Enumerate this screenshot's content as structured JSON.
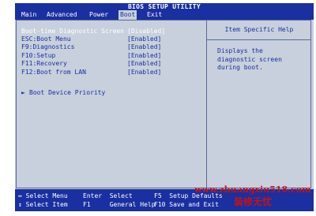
{
  "window": {
    "title": "BIOS SETUP UTILITY"
  },
  "menubar": {
    "items": [
      "Main",
      "Advanced",
      "Power",
      "Boot",
      "Exit"
    ],
    "active": "Boot"
  },
  "settings": [
    {
      "label": "Boot-time Diagnostic Screen",
      "value": "[Disabled]",
      "selected": true
    },
    {
      "label": "ESC:Boot Menu",
      "value": "[Enabled]"
    },
    {
      "label": "F9:Diagnostics",
      "value": "[Enabled]"
    },
    {
      "label": "F10:Setup",
      "value": "[Enabled]"
    },
    {
      "label": "F11:Recovery",
      "value": "[Enabled]"
    },
    {
      "label": "F12:Boot from LAN",
      "value": "[Enabled]"
    }
  ],
  "submenu": {
    "arrow": "►",
    "label": "Boot Device Priority"
  },
  "help": {
    "title": "Item Specific Help",
    "text": "Displays the\ndiagnostic screen\nduring boot."
  },
  "footer": {
    "keys": [
      {
        "key": "↔",
        "desc": "Select Menu"
      },
      {
        "key": "↕",
        "desc": "Select Item"
      },
      {
        "key": "Enter",
        "desc": "Select"
      },
      {
        "key": "F1",
        "desc": "General Help"
      },
      {
        "key": "F5",
        "desc": "Setup Defaults"
      },
      {
        "key": "F10",
        "desc": "Save and Exit"
      }
    ]
  },
  "watermark": {
    "url": "www.zhuangxiu518.com",
    "brand": "装修无忧"
  },
  "colors": {
    "bios_blue": "#1a2fa0",
    "panel_gray": "#c7d0dc",
    "watermark_red": "#c0141a"
  }
}
